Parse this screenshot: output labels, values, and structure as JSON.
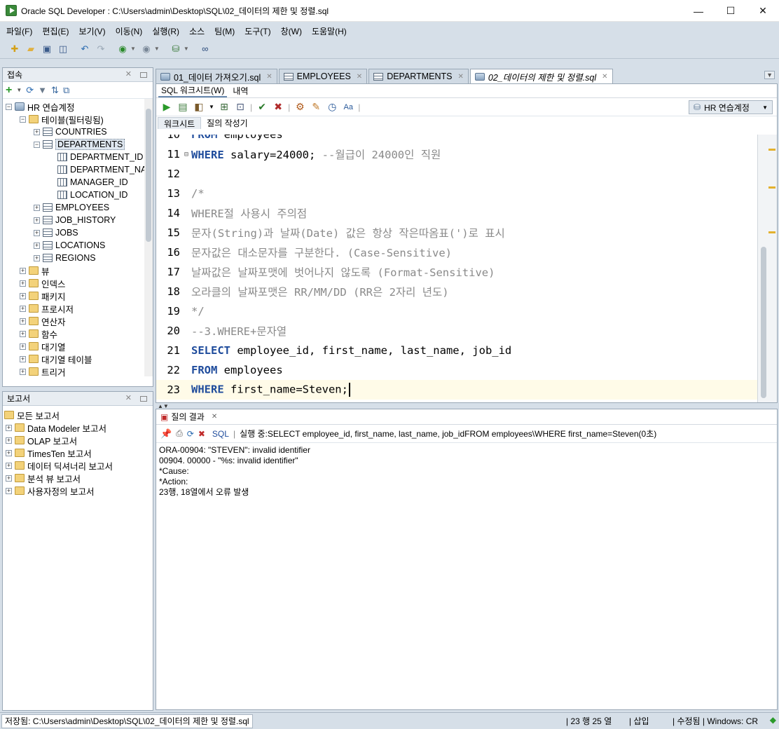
{
  "window": {
    "title": "Oracle SQL Developer : C:\\Users\\admin\\Desktop\\SQL\\02_데이터의 제한 및 정렬.sql",
    "minimize": "—",
    "maximize": "☐",
    "close": "✕"
  },
  "menu": {
    "items": [
      "파일(F)",
      "편집(E)",
      "보기(V)",
      "이동(N)",
      "실행(R)",
      "소스",
      "팀(M)",
      "도구(T)",
      "창(W)",
      "도움말(H)"
    ]
  },
  "connections_panel": {
    "title": "접속",
    "tree": [
      {
        "label": "HR 연습계정",
        "level": 0,
        "icon": "database-icon",
        "expander": "−"
      },
      {
        "label": "테이블(필터링됨)",
        "level": 1,
        "icon": "folder-icon",
        "expander": "−"
      },
      {
        "label": "COUNTRIES",
        "level": 2,
        "icon": "table-icon",
        "expander": "+"
      },
      {
        "label": "DEPARTMENTS",
        "level": 2,
        "icon": "table-icon",
        "expander": "−",
        "selected": true
      },
      {
        "label": "DEPARTMENT_ID",
        "level": 3,
        "icon": "column-icon"
      },
      {
        "label": "DEPARTMENT_NAME",
        "level": 3,
        "icon": "column-icon"
      },
      {
        "label": "MANAGER_ID",
        "level": 3,
        "icon": "column-icon"
      },
      {
        "label": "LOCATION_ID",
        "level": 3,
        "icon": "column-icon"
      },
      {
        "label": "EMPLOYEES",
        "level": 2,
        "icon": "table-icon",
        "expander": "+"
      },
      {
        "label": "JOB_HISTORY",
        "level": 2,
        "icon": "table-icon",
        "expander": "+"
      },
      {
        "label": "JOBS",
        "level": 2,
        "icon": "table-icon",
        "expander": "+"
      },
      {
        "label": "LOCATIONS",
        "level": 2,
        "icon": "table-icon",
        "expander": "+"
      },
      {
        "label": "REGIONS",
        "level": 2,
        "icon": "table-icon",
        "expander": "+"
      },
      {
        "label": "뷰",
        "level": 1,
        "icon": "folder-icon",
        "expander": "+"
      },
      {
        "label": "인덱스",
        "level": 1,
        "icon": "folder-icon",
        "expander": "+"
      },
      {
        "label": "패키지",
        "level": 1,
        "icon": "folder-icon",
        "expander": "+"
      },
      {
        "label": "프로시저",
        "level": 1,
        "icon": "folder-icon",
        "expander": "+"
      },
      {
        "label": "연산자",
        "level": 1,
        "icon": "folder-icon",
        "expander": "+"
      },
      {
        "label": "함수",
        "level": 1,
        "icon": "folder-icon",
        "expander": "+"
      },
      {
        "label": "대기열",
        "level": 1,
        "icon": "folder-icon",
        "expander": "+"
      },
      {
        "label": "대기열 테이블",
        "level": 1,
        "icon": "folder-icon",
        "expander": "+"
      },
      {
        "label": "트리거",
        "level": 1,
        "icon": "folder-icon",
        "expander": "+"
      }
    ]
  },
  "reports_panel": {
    "title": "보고서",
    "tree": [
      {
        "label": "모든 보고서",
        "level": 0
      },
      {
        "label": "Data Modeler 보고서",
        "level": 1
      },
      {
        "label": "OLAP 보고서",
        "level": 1
      },
      {
        "label": "TimesTen 보고서",
        "level": 1
      },
      {
        "label": "데이터 딕셔너리 보고서",
        "level": 1
      },
      {
        "label": "분석 뷰 보고서",
        "level": 1
      },
      {
        "label": "사용자정의 보고서",
        "level": 1
      }
    ]
  },
  "editor_tabs": [
    {
      "label": "01_데이터 가져오기.sql",
      "icon": "sql-file-icon"
    },
    {
      "label": "EMPLOYEES",
      "icon": "table-icon"
    },
    {
      "label": "DEPARTMENTS",
      "icon": "table-icon"
    },
    {
      "label": "02_데이터의 제한 및 정렬.sql",
      "icon": "sql-file-icon",
      "active": true
    }
  ],
  "editor": {
    "subtabs": [
      "SQL 워크시트(W)",
      "내역"
    ],
    "connection": "HR 연습계정",
    "ws_tabs": [
      "워크시트",
      "질의 작성기"
    ],
    "lines": [
      {
        "n": "10",
        "tokens": [
          {
            "t": "kw",
            "v": "FROM"
          },
          {
            "t": "tx",
            "v": " employees"
          }
        ]
      },
      {
        "n": "11",
        "fold": "⊟",
        "tokens": [
          {
            "t": "kw",
            "v": "WHERE"
          },
          {
            "t": "tx",
            "v": " salary="
          },
          {
            "t": "tx",
            "v": "24000"
          },
          {
            "t": "tx",
            "v": "; "
          },
          {
            "t": "cm",
            "v": "--월급이 24000인 직원"
          }
        ]
      },
      {
        "n": "12",
        "tokens": []
      },
      {
        "n": "13",
        "tokens": [
          {
            "t": "cm",
            "v": "/*"
          }
        ]
      },
      {
        "n": "14",
        "tokens": [
          {
            "t": "cm",
            "v": "WHERE절 사용시 주의점"
          }
        ]
      },
      {
        "n": "15",
        "tokens": [
          {
            "t": "cm",
            "v": "문자(String)과 날짜(Date) 값은 항상 작은따옴표(')로 표시"
          }
        ]
      },
      {
        "n": "16",
        "tokens": [
          {
            "t": "cm",
            "v": "문자값은 대소문자를 구분한다. (Case-Sensitive)"
          }
        ]
      },
      {
        "n": "17",
        "tokens": [
          {
            "t": "cm",
            "v": "날짜값은 날짜포맷에 벗어나지 않도록 (Format-Sensitive)"
          }
        ]
      },
      {
        "n": "18",
        "tokens": [
          {
            "t": "cm",
            "v": "오라클의 날짜포맷은 RR/MM/DD (RR은 2자리 년도)"
          }
        ]
      },
      {
        "n": "19",
        "tokens": [
          {
            "t": "cm",
            "v": "*/"
          }
        ]
      },
      {
        "n": "20",
        "tokens": [
          {
            "t": "cm",
            "v": "--3.WHERE+문자열"
          }
        ]
      },
      {
        "n": "21",
        "tokens": [
          {
            "t": "kw",
            "v": "SELECT"
          },
          {
            "t": "tx",
            "v": " employee_id, first_name, last_name, job_id"
          }
        ]
      },
      {
        "n": "22",
        "tokens": [
          {
            "t": "kw",
            "v": "FROM"
          },
          {
            "t": "tx",
            "v": " employees"
          }
        ]
      },
      {
        "n": "23",
        "tokens": [
          {
            "t": "kw",
            "v": "WHERE"
          },
          {
            "t": "tx",
            "v": " first_name=Steven;"
          }
        ],
        "current": true
      }
    ]
  },
  "results": {
    "tab_label": "질의 결과",
    "sql_label": "SQL",
    "status": "실행 중:SELECT employee_id, first_name, last_name, job_idFROM employees\\WHERE first_name=Steven(0초)",
    "lines": [
      "ORA-00904: \"STEVEN\": invalid identifier",
      "00904. 00000 -  \"%s: invalid identifier\"",
      "*Cause:",
      "*Action:",
      "23행, 18열에서 오류 발생"
    ]
  },
  "statusbar": {
    "path": "저장됨: C:\\Users\\admin\\Desktop\\SQL\\02_데이터의 제한 및 정렬.sql",
    "position": "| 23 행 25 열",
    "insert_mode": "| 삽입",
    "modified": "| 수정됨 | Windows: CR"
  },
  "colors": {
    "keyword": "#1f4c9c",
    "comment": "#8a8a8a",
    "chrome": "#d6dfe8",
    "marker": "#e3b12e"
  }
}
